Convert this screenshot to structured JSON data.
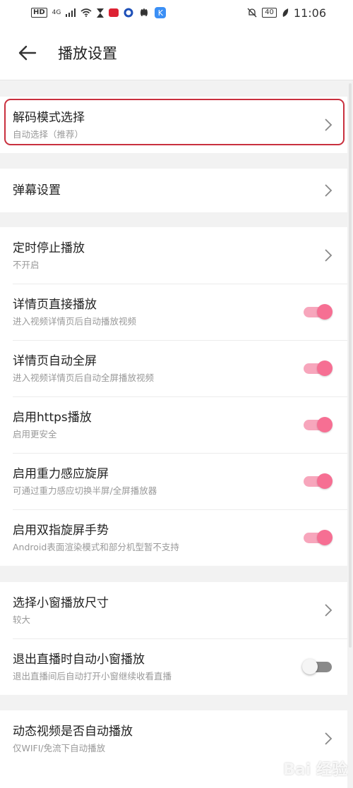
{
  "status_bar": {
    "network": "HD",
    "signal": "4G",
    "battery": "40",
    "time": "11:06",
    "k_label": "K"
  },
  "header": {
    "title": "播放设置"
  },
  "colors": {
    "accent": "#f66f93",
    "highlight": "#c9303e"
  },
  "groups": [
    {
      "items": [
        {
          "title": "解码模式选择",
          "subtitle": "自动选择（推荐）",
          "control": "chevron"
        }
      ]
    },
    {
      "items": [
        {
          "title": "弹幕设置",
          "control": "chevron"
        }
      ]
    },
    {
      "items": [
        {
          "title": "定时停止播放",
          "subtitle": "不开启",
          "control": "chevron"
        },
        {
          "title": "详情页直接播放",
          "subtitle": "进入视频详情页后自动播放视频",
          "control": "toggle",
          "on": true
        },
        {
          "title": "详情页自动全屏",
          "subtitle": "进入视频详情页后自动全屏播放视频",
          "control": "toggle",
          "on": true
        },
        {
          "title": "启用https播放",
          "subtitle": "启用更安全",
          "control": "toggle",
          "on": true
        },
        {
          "title": "启用重力感应旋屏",
          "subtitle": "可通过重力感应切换半屏/全屏播放器",
          "control": "toggle",
          "on": true
        },
        {
          "title": "启用双指旋屏手势",
          "subtitle": "Android表面渲染模式和部分机型暂不支持",
          "control": "toggle",
          "on": true
        }
      ]
    },
    {
      "items": [
        {
          "title": "选择小窗播放尺寸",
          "subtitle": "较大",
          "control": "chevron"
        },
        {
          "title": "退出直播时自动小窗播放",
          "subtitle": "退出直播间后自动打开小窗继续收看直播",
          "control": "toggle",
          "on": false
        }
      ]
    },
    {
      "items": [
        {
          "title": "动态视频是否自动播放",
          "subtitle": "仅WIFI/免流下自动播放",
          "control": "chevron"
        }
      ]
    }
  ],
  "watermark": "Bai 经验"
}
